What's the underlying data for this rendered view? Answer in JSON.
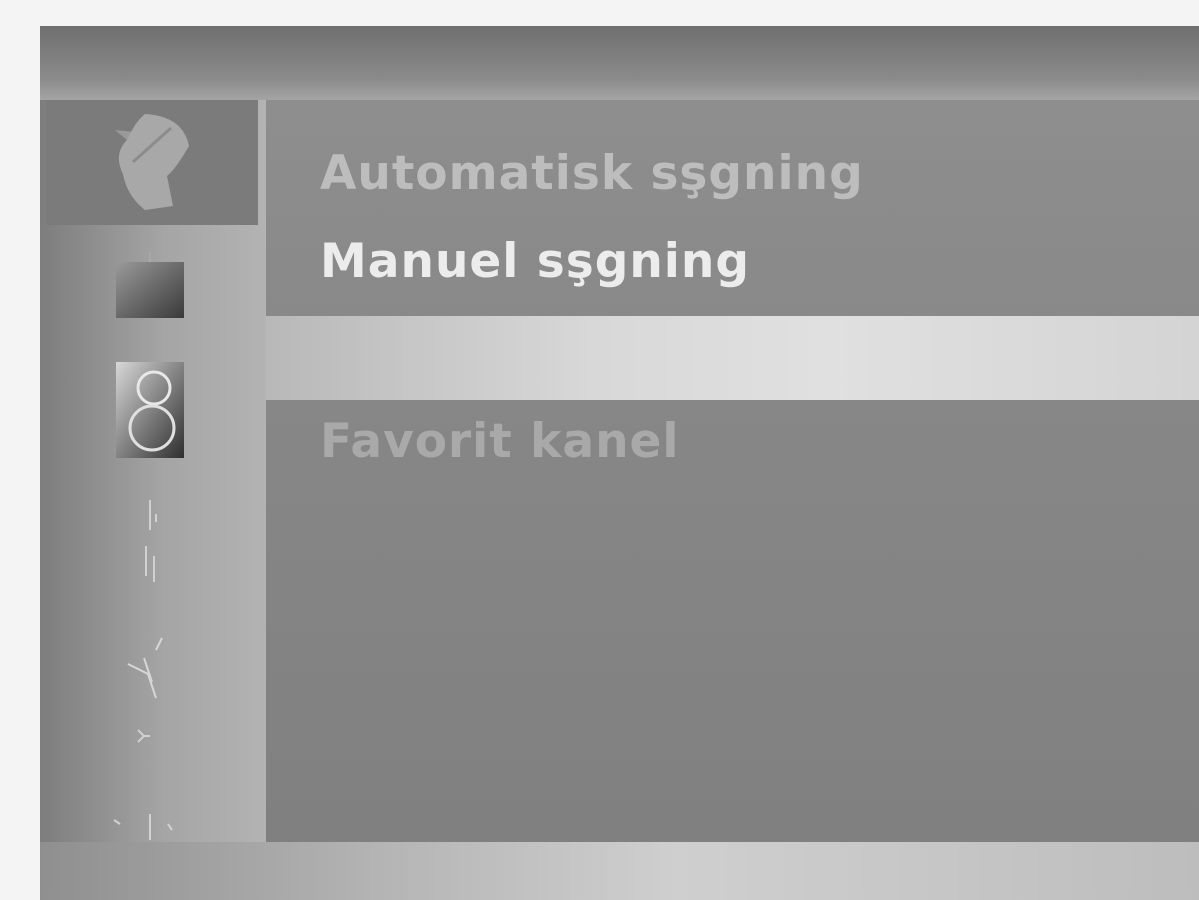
{
  "menu": {
    "items": [
      {
        "label": "Automatisk sşgning",
        "state": "normal"
      },
      {
        "label": "Manuel sşgning",
        "state": "selected"
      },
      {
        "label": "Favorit kanel",
        "state": "normal"
      }
    ]
  },
  "sidebar": {
    "icons": [
      "satellite-dish-icon",
      "picture-icon",
      "sound-icon",
      "time-icon",
      "option-icon",
      "lock-icon",
      "setup-icon"
    ],
    "active_index": 0
  },
  "colors": {
    "panel": "#8a8a8a",
    "highlight_text": "#ececec",
    "dim_text": "#bdbdbd",
    "separator": "#d8d8d8"
  }
}
